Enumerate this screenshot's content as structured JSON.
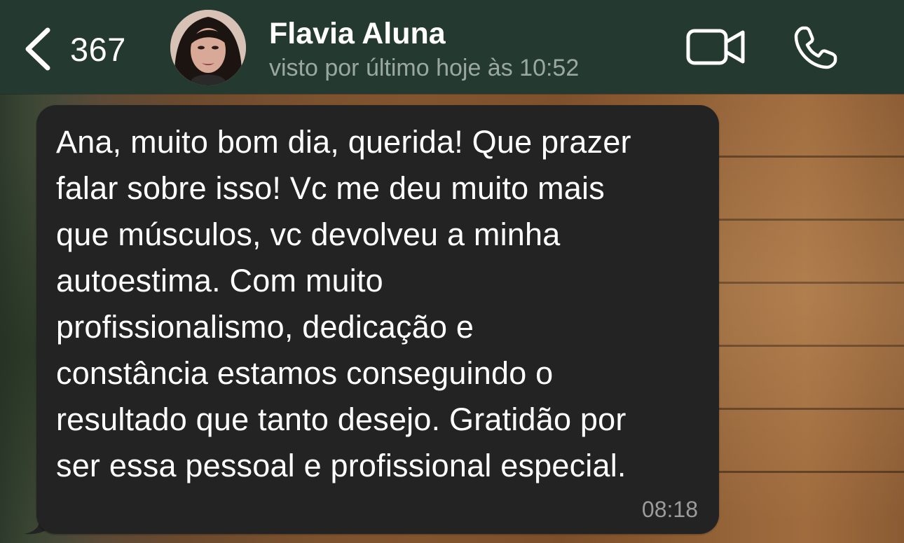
{
  "header": {
    "back_count": "367",
    "contact_name": "Flavia Aluna",
    "last_seen": "visto por último hoje às 10:52"
  },
  "message": {
    "text": "Ana, muito bom dia, querida! Que prazer\nfalar sobre isso! Vc me deu muito mais\nque músculos, vc devolveu a minha\nautoestima. Com muito\nprofissionalismo, dedicação e\nconstância estamos conseguindo o\nresultado que tanto desejo. Gratidão por\nser essa pessoal e profissional especial.",
    "time": "08:18"
  },
  "icons": {
    "back": "chevron-left-icon",
    "video": "video-camera-icon",
    "call": "phone-icon"
  },
  "colors": {
    "header_bg": "#243a30",
    "bubble_bg": "#232323",
    "text": "#ffffff",
    "secondary_text": "#9aa8a0"
  }
}
